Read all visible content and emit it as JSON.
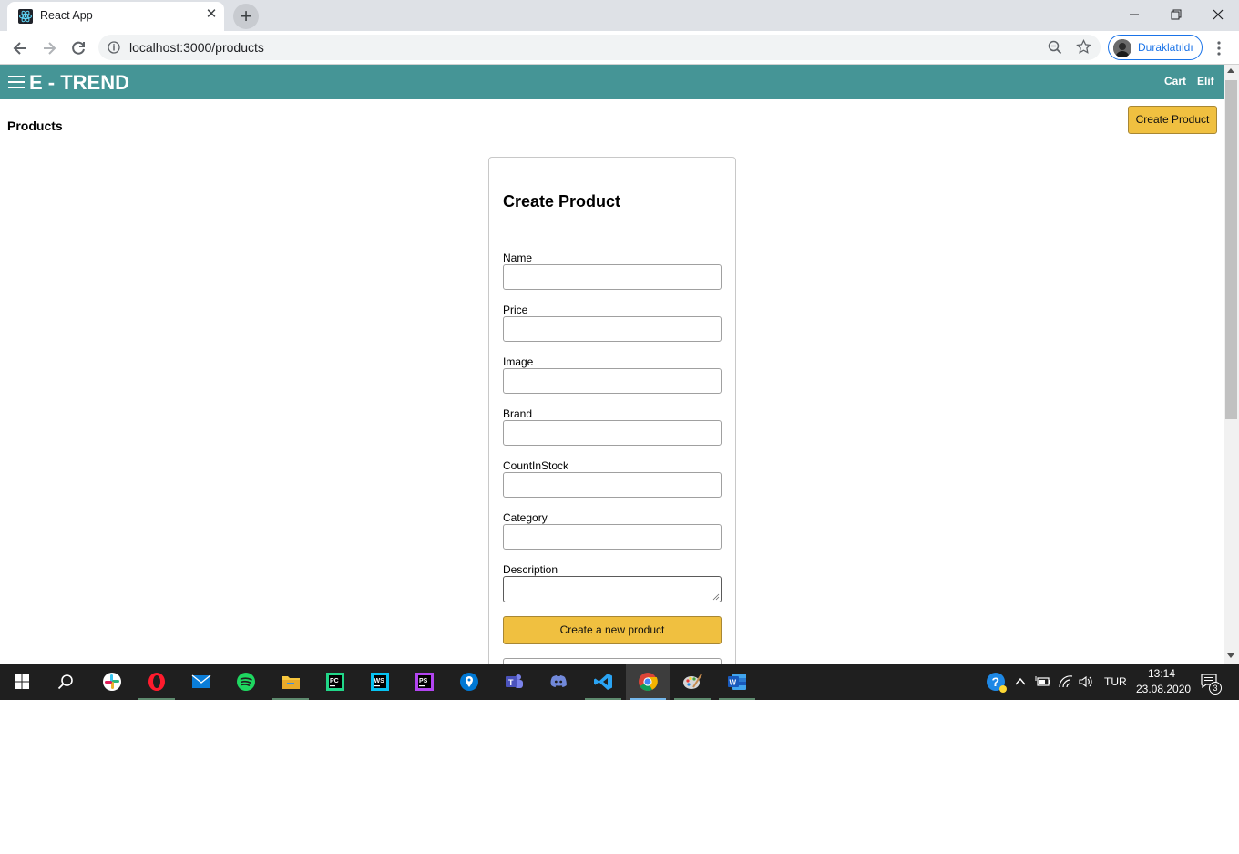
{
  "browser": {
    "tab_title": "React App",
    "url": "localhost:3000/products",
    "profile_label": "Duraklatıldı"
  },
  "app": {
    "brand": "E - TREND",
    "nav": {
      "cart": "Cart",
      "user": "Elif"
    },
    "page_title": "Products",
    "top_button": "Create Product"
  },
  "form": {
    "title": "Create Product",
    "fields": [
      {
        "label": "Name",
        "value": ""
      },
      {
        "label": "Price",
        "value": ""
      },
      {
        "label": "Image",
        "value": ""
      },
      {
        "label": "Brand",
        "value": ""
      },
      {
        "label": "CountInStock",
        "value": ""
      },
      {
        "label": "Category",
        "value": ""
      },
      {
        "label": "Description",
        "value": ""
      }
    ],
    "submit_label": "Create a new product"
  },
  "taskbar": {
    "apps": [
      "start-icon",
      "search-icon",
      "slack-icon",
      "opera-icon",
      "mail-icon",
      "spotify-icon",
      "file-explorer-icon",
      "pycharm-icon",
      "webstorm-icon",
      "phpstorm-icon",
      "maps-icon",
      "teams-icon",
      "discord-icon",
      "vscode-icon",
      "chrome-icon",
      "paint-icon",
      "word-icon"
    ],
    "language": "TUR",
    "time": "13:14",
    "date": "23.08.2020",
    "notification_count": "3"
  },
  "colors": {
    "header": "#459596",
    "accent_button": "#f0c040",
    "taskbar": "#1f1f1f"
  }
}
